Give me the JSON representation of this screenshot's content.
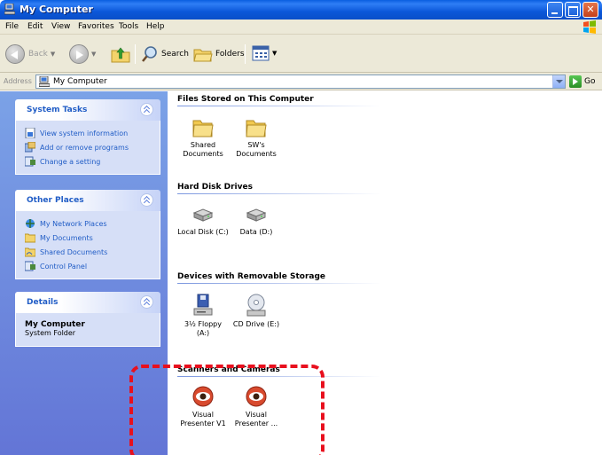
{
  "window": {
    "title": "My Computer"
  },
  "menu": [
    "File",
    "Edit",
    "View",
    "Favorites",
    "Tools",
    "Help"
  ],
  "toolbar": {
    "back_label": "Back",
    "search_label": "Search",
    "folders_label": "Folders"
  },
  "address": {
    "label": "Address",
    "value": "My Computer",
    "go_label": "Go"
  },
  "left_pane": {
    "system_tasks": {
      "title": "System Tasks",
      "items": [
        "View system information",
        "Add or remove programs",
        "Change a setting"
      ]
    },
    "other_places": {
      "title": "Other Places",
      "items": [
        "My Network Places",
        "My Documents",
        "Shared Documents",
        "Control Panel"
      ]
    },
    "details": {
      "title": "Details",
      "name": "My Computer",
      "type": "System Folder"
    }
  },
  "groups": [
    {
      "title": "Files Stored on This Computer",
      "items": [
        {
          "line1": "Shared",
          "line2": "Documents"
        },
        {
          "line1": "SW's",
          "line2": "Documents"
        }
      ]
    },
    {
      "title": "Hard Disk Drives",
      "items": [
        {
          "line1": "Local Disk (C:)",
          "line2": ""
        },
        {
          "line1": "Data (D:)",
          "line2": ""
        }
      ]
    },
    {
      "title": "Devices with Removable Storage",
      "items": [
        {
          "line1": "3½ Floppy",
          "line2": "(A:)"
        },
        {
          "line1": "CD Drive (E:)",
          "line2": ""
        }
      ]
    },
    {
      "title": "Scanners and Cameras",
      "items": [
        {
          "line1": "Visual",
          "line2": "Presenter V1"
        },
        {
          "line1": "Visual",
          "line2": "Presenter ..."
        }
      ]
    }
  ],
  "colors": {
    "titlebar": "#0b57d9",
    "left_pane": "#6f8fe0",
    "link": "#215dc6",
    "highlight": "#e8101e"
  }
}
